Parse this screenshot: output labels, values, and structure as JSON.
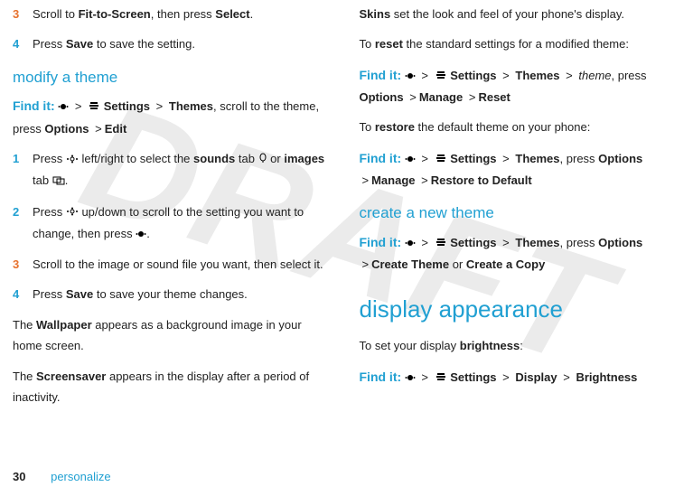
{
  "watermark": "DRAFT",
  "left": {
    "step3_num": "3",
    "step3_a": "Scroll to ",
    "step3_b": "Fit-to-Screen",
    "step3_c": ", then press ",
    "step3_d": "Select",
    "step3_e": ".",
    "step4_num": "4",
    "step4_a": "Press ",
    "step4_b": "Save",
    "step4_c": " to save the setting.",
    "h_modify": "modify a theme",
    "find1_a": "Settings",
    "find1_b": "Themes",
    "find1_c": ", scroll to the theme, press ",
    "find1_d": "Options",
    "find1_e": "Edit",
    "s1_num": "1",
    "s1_a": "Press ",
    "s1_b": " left/right to select the ",
    "s1_c": "sounds",
    "s1_d": " tab ",
    "s1_e": " or ",
    "s1_f": "images",
    "s1_g": " tab ",
    "s1_h": ".",
    "s2_num": "2",
    "s2_a": "Press ",
    "s2_b": " up/down to scroll to the setting you want to change, then press ",
    "s2_c": ".",
    "s3_num": "3",
    "s3_a": "Scroll to the image or sound file you want, then select it.",
    "s4_num": "4",
    "s4_a": "Press ",
    "s4_b": "Save",
    "s4_c": " to save your theme changes.",
    "p_wall_a": "The ",
    "p_wall_b": "Wallpaper",
    "p_wall_c": " appears as a background image in your home screen.",
    "p_ss_a": "The ",
    "p_ss_b": "Screensaver",
    "p_ss_c": " appears in the display after a period of inactivity."
  },
  "right": {
    "p_skins_a": "Skins",
    "p_skins_b": " set the look and feel of your phone's display.",
    "p_reset_a": "To ",
    "p_reset_b": "reset",
    "p_reset_c": " the standard settings for a modified theme:",
    "find2_a": "Settings",
    "find2_b": "Themes",
    "find2_c": "theme",
    "find2_d": ", press ",
    "find2_e": "Options",
    "find2_f": "Manage",
    "find2_g": "Reset",
    "p_restore_a": "To ",
    "p_restore_b": "restore",
    "p_restore_c": " the default theme on your phone:",
    "find3_a": "Settings",
    "find3_b": "Themes",
    "find3_c": ", press ",
    "find3_d": "Options",
    "find3_e": "Manage",
    "find3_f": "Restore to Default",
    "h_create": "create a new theme",
    "find4_a": "Settings",
    "find4_b": "Themes",
    "find4_c": ", press ",
    "find4_d": "Options",
    "find4_e": "Create Theme",
    "find4_f": " or ",
    "find4_g": "Create a Copy",
    "h_display": "display appearance",
    "p_bright_a": "To set your display ",
    "p_bright_b": "brightness",
    "p_bright_c": ":",
    "find5_a": "Settings",
    "find5_b": "Display",
    "find5_c": "Brightness"
  },
  "common": {
    "findit": "Find it:",
    "gt": ">"
  },
  "footer": {
    "page": "30",
    "section": "personalize"
  }
}
